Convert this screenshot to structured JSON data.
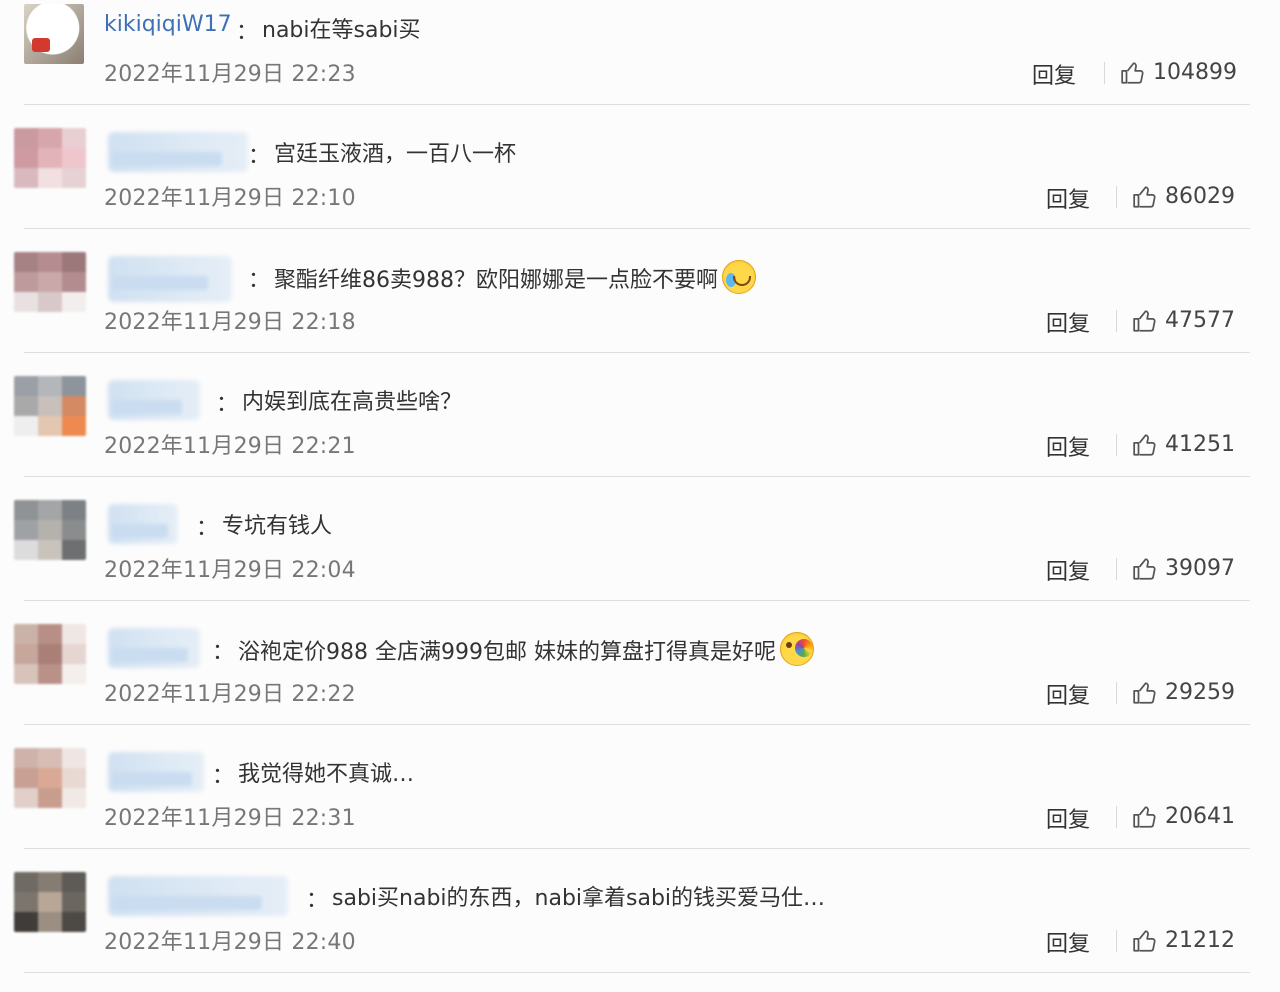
{
  "comments": [
    {
      "user": "kikiqiqiW17",
      "colon": "：",
      "text": "nabi在等sabi买",
      "time": "2022年11月29日 22:23",
      "reply": "回复",
      "likes": "104899",
      "user_visible": true
    },
    {
      "user": "",
      "colon": "：",
      "text": "宫廷玉液酒，一百八一杯",
      "time": "2022年11月29日 22:10",
      "reply": "回复",
      "likes": "86029",
      "user_visible": false
    },
    {
      "user": "",
      "colon": "：",
      "text": "聚酯纤维86卖988？欧阳娜娜是一点脸不要啊",
      "emoji": "crying-laughing-emoji",
      "time": "2022年11月29日 22:18",
      "reply": "回复",
      "likes": "47577",
      "user_visible": false
    },
    {
      "user": "",
      "colon": "：",
      "text": "内娱到底在高贵些啥？",
      "time": "2022年11月29日 22:21",
      "reply": "回复",
      "likes": "41251",
      "user_visible": false
    },
    {
      "user": "",
      "colon": "：",
      "text": "专坑有钱人",
      "time": "2022年11月29日 22:04",
      "reply": "回复",
      "likes": "39097",
      "user_visible": false
    },
    {
      "user": "",
      "colon": "：",
      "text": "浴袍定价988 全店满999包邮 妹妹的算盘打得真是好呢",
      "emoji": "rainbow-vomit-emoji",
      "time": "2022年11月29日 22:22",
      "reply": "回复",
      "likes": "29259",
      "user_visible": false
    },
    {
      "user": "",
      "colon": "：",
      "text": "我觉得她不真诚…",
      "time": "2022年11月29日 22:31",
      "reply": "回复",
      "likes": "20641",
      "user_visible": false
    },
    {
      "user": "",
      "colon": "：",
      "text": "sabi买nabi的东西，nabi拿着sabi的钱买爱马仕…",
      "time": "2022年11月29日 22:40",
      "reply": "回复",
      "likes": "21212",
      "user_visible": false
    }
  ],
  "icons": {
    "like": "thumbs-up-icon"
  },
  "colors": {
    "username": "#3f70b5",
    "time": "#777777",
    "text": "#333333",
    "divider": "#dedede"
  }
}
